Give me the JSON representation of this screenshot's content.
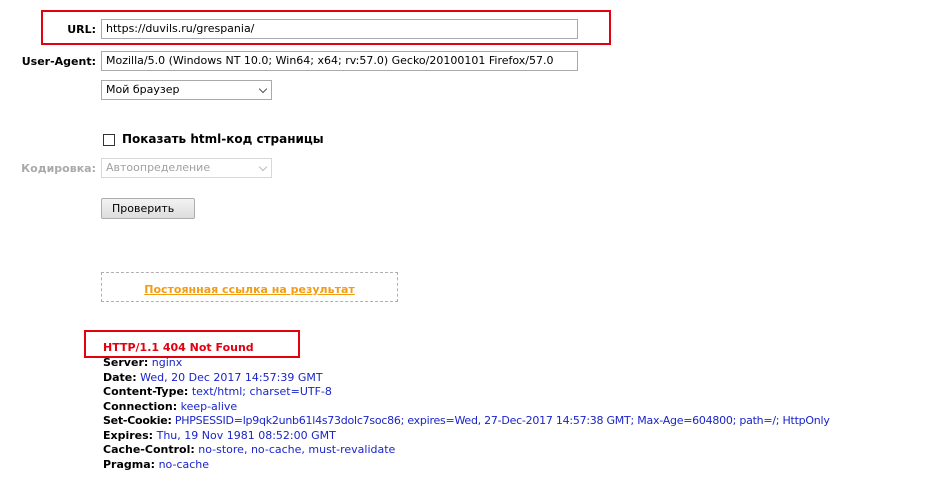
{
  "form": {
    "url_label": "URL:",
    "url_value": "https://duvils.ru/grespania/",
    "ua_label": "User-Agent:",
    "ua_value": "Mozilla/5.0 (Windows NT 10.0; Win64; x64; rv:57.0) Gecko/20100101 Firefox/57.0",
    "browser_select": "Мой браузер",
    "show_html_label": "Показать html-код страницы",
    "show_html_checked": false,
    "encoding_label": "Кодировка:",
    "encoding_select": "Автоопределение",
    "check_button": "Проверить"
  },
  "permalink": "Постоянная ссылка на результат",
  "response": {
    "status": "HTTP/1.1 404 Not Found",
    "headers": [
      {
        "name": "Server:",
        "value": "nginx"
      },
      {
        "name": "Date:",
        "value": "Wed, 20 Dec 2017 14:57:39 GMT"
      },
      {
        "name": "Content-Type:",
        "value": "text/html; charset=UTF-8"
      },
      {
        "name": "Connection:",
        "value": "keep-alive"
      },
      {
        "name": "Set-Cookie:",
        "value": "PHPSESSID=lp9qk2unb61l4s73dolc7soc86; expires=Wed, 27-Dec-2017 14:57:38 GMT; Max-Age=604800; path=/; HttpOnly"
      },
      {
        "name": "Expires:",
        "value": "Thu, 19 Nov 1981 08:52:00 GMT"
      },
      {
        "name": "Cache-Control:",
        "value": "no-store, no-cache, must-revalidate"
      },
      {
        "name": "Pragma:",
        "value": "no-cache"
      }
    ]
  },
  "colors": {
    "highlight": "#e3000f",
    "header_value": "#1a24c9",
    "permalink": "#f39c12"
  }
}
